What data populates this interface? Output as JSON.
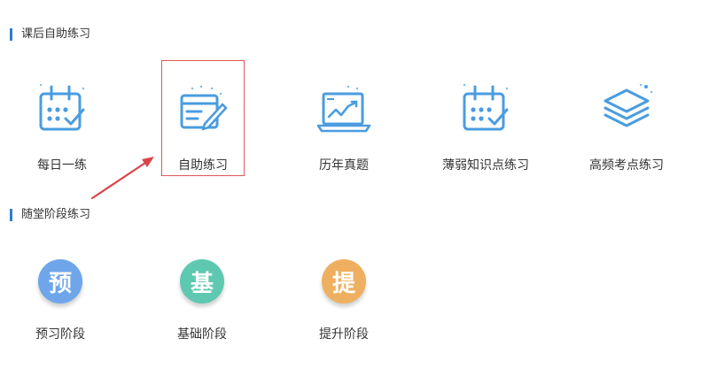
{
  "sections": {
    "self_practice": {
      "title": "课后自助练习",
      "items": [
        {
          "label": "每日一练",
          "icon": "calendar-check-icon"
        },
        {
          "label": "自助练习",
          "icon": "notebook-pen-icon"
        },
        {
          "label": "历年真题",
          "icon": "laptop-chart-icon"
        },
        {
          "label": "薄弱知识点练习",
          "icon": "calendar-check-icon"
        },
        {
          "label": "高频考点练习",
          "icon": "layers-stack-icon"
        }
      ]
    },
    "stage_practice": {
      "title": "随堂阶段练习",
      "items": [
        {
          "label": "预习阶段",
          "glyph": "预",
          "color": "#6fa6ea"
        },
        {
          "label": "基础阶段",
          "glyph": "基",
          "color": "#5ec9b0"
        },
        {
          "label": "提升阶段",
          "glyph": "提",
          "color": "#eeb060"
        }
      ]
    }
  },
  "colors": {
    "accent": "#2e7cd6",
    "icon_stroke": "#4a9ce0",
    "highlight": "#e0575a"
  }
}
